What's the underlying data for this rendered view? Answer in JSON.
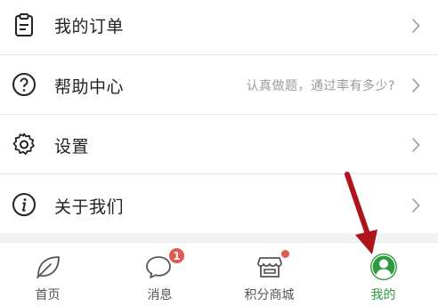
{
  "menu": {
    "items": [
      {
        "label": "我的订单",
        "hint": "",
        "icon": "clipboard-icon"
      },
      {
        "label": "帮助中心",
        "hint": "认真做题，通过率有多少?",
        "icon": "question-circle-icon"
      },
      {
        "label": "设置",
        "hint": "",
        "icon": "gear-icon"
      },
      {
        "label": "关于我们",
        "hint": "",
        "icon": "info-circle-icon"
      }
    ]
  },
  "tabbar": {
    "tabs": [
      {
        "label": "首页",
        "icon": "leaf-icon",
        "active": false
      },
      {
        "label": "消息",
        "icon": "chat-bubble-icon",
        "active": false,
        "badge": "1"
      },
      {
        "label": "积分商城",
        "icon": "shop-icon",
        "active": false,
        "dot": true
      },
      {
        "label": "我的",
        "icon": "user-circle-icon",
        "active": true
      }
    ]
  },
  "colors": {
    "accent": "#2e9b3e",
    "badge": "#e25a4f",
    "annotation_arrow": "#b0141b"
  }
}
